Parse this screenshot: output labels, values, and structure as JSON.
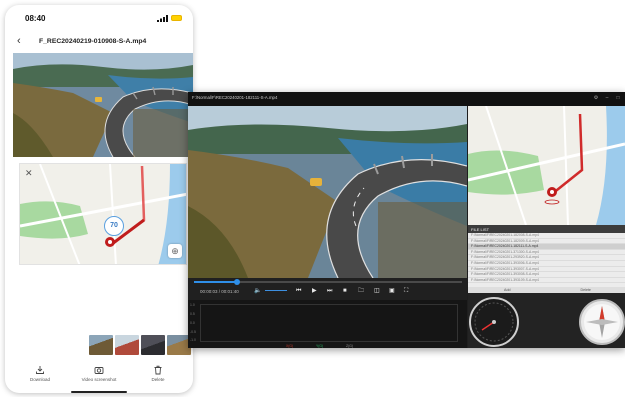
{
  "phone": {
    "status_time": "08:40",
    "title": "F_REC20240219-010908-S-A.mp4",
    "back_icon": "chevron-left-icon",
    "map": {
      "speed_value": "70",
      "close_icon": "close-icon",
      "locate_icon": "crosshair-icon"
    },
    "toolbar": [
      {
        "label": "Download",
        "icon": "download-icon"
      },
      {
        "label": "Video screenshot",
        "icon": "camera-icon"
      },
      {
        "label": "Delete",
        "icon": "trash-icon"
      }
    ],
    "thumb_count": 4
  },
  "desktop": {
    "title": "F:\\Normal\\F\\REC20240201-182111-S-A.mp4",
    "controls": {
      "time": "00:00:03 / 00:01:40",
      "progress_fraction": 0.16
    },
    "file_list": {
      "header": "FILE LIST",
      "files": [
        "F:\\Normal\\F\\REC20240201-182008-S-A.mp4",
        "F:\\Normal\\F\\REC20240201-182009-S-A.mp4",
        "F:\\Normal\\F\\REC20240201-182111-S-A.mp4",
        "F:\\Normal\\F\\REC20240201-371300-S-A.mp4",
        "F:\\Normal\\F\\REC20240201-293920-S-A.mp4",
        "F:\\Normal\\F\\REC20240201-393006-S-A.mp4",
        "F:\\Normal\\F\\REC20240201-393007-S-A.mp4",
        "F:\\Normal\\F\\REC20240201-393008-S-A.mp4",
        "F:\\Normal\\F\\REC20240201-393109-S-A.mp4"
      ],
      "selected_index": 2,
      "actions": [
        "Add",
        "Delete"
      ]
    },
    "graph": {
      "y_labels": [
        "1.0",
        "0.5",
        "0.0",
        "-0.5",
        "-1.0"
      ],
      "legend": [
        {
          "label": "X(G)",
          "color": "#c0392b"
        },
        {
          "label": "Y(G)",
          "color": "#27ae60"
        },
        {
          "label": "Z(G)",
          "color": "#8e8e8e"
        }
      ]
    },
    "gauges": {
      "speedometer_icon": "speedometer-icon",
      "compass_icon": "compass-icon"
    }
  },
  "colors": {
    "accent": "#2f8fe8",
    "route": "#d62b2b",
    "water": "#8fc3e6",
    "park": "#9fd49a"
  }
}
